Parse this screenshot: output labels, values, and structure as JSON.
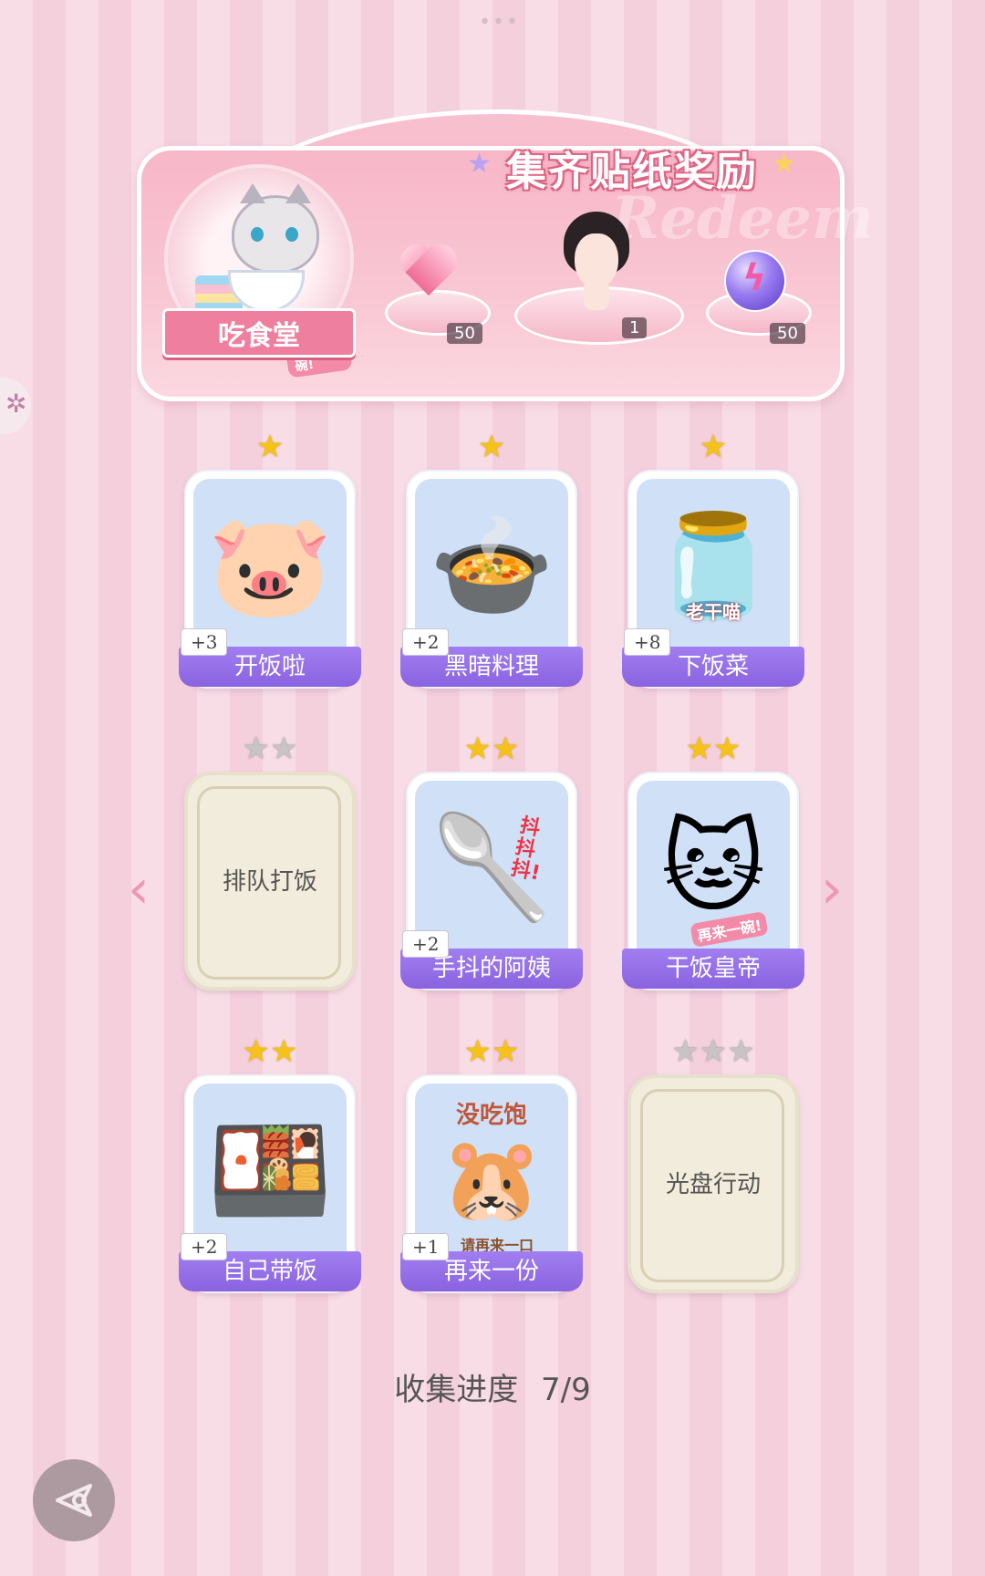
{
  "banner": {
    "title": "集齐贴纸奖励",
    "watermark": "Redeem",
    "theme_label": "吃食堂",
    "theme_badge": "再来一碗!",
    "rewards": [
      {
        "icon": "heart-gem-icon",
        "count": "50"
      },
      {
        "icon": "girl-avatar-icon",
        "count": "1"
      },
      {
        "icon": "energy-orb-icon",
        "count": "50"
      }
    ]
  },
  "cards": [
    {
      "name": "开饭啦",
      "plus": "+3",
      "stars": 1,
      "max_stars": 1,
      "collected": true,
      "art": "🐷"
    },
    {
      "name": "黑暗料理",
      "plus": "+2",
      "stars": 1,
      "max_stars": 1,
      "collected": true,
      "art": "🍲"
    },
    {
      "name": "下饭菜",
      "plus": "+8",
      "stars": 1,
      "max_stars": 1,
      "collected": true,
      "art": "🫙",
      "art_text": "老干喵"
    },
    {
      "name": "排队打饭",
      "plus": "",
      "stars": 0,
      "max_stars": 2,
      "collected": false
    },
    {
      "name": "手抖的阿姨",
      "plus": "+2",
      "stars": 2,
      "max_stars": 2,
      "collected": true,
      "art": "🥄",
      "art_text": "抖抖抖!"
    },
    {
      "name": "干饭皇帝",
      "plus": "",
      "stars": 2,
      "max_stars": 2,
      "collected": true,
      "art": "🐱",
      "art_text": "再来一碗!"
    },
    {
      "name": "自己带饭",
      "plus": "+2",
      "stars": 2,
      "max_stars": 2,
      "collected": true,
      "art": "🍱"
    },
    {
      "name": "再来一份",
      "plus": "+1",
      "stars": 2,
      "max_stars": 2,
      "collected": true,
      "art": "🐹",
      "art_text": "没吃饱",
      "art_text2": "请再来一口"
    },
    {
      "name": "光盘行动",
      "plus": "",
      "stars": 0,
      "max_stars": 3,
      "collected": false
    }
  ],
  "progress": {
    "label": "收集进度",
    "value": "7/9"
  },
  "colors": {
    "accent": "#8a63e0",
    "pink": "#ef7f9f",
    "gold": "#f5c21a"
  }
}
